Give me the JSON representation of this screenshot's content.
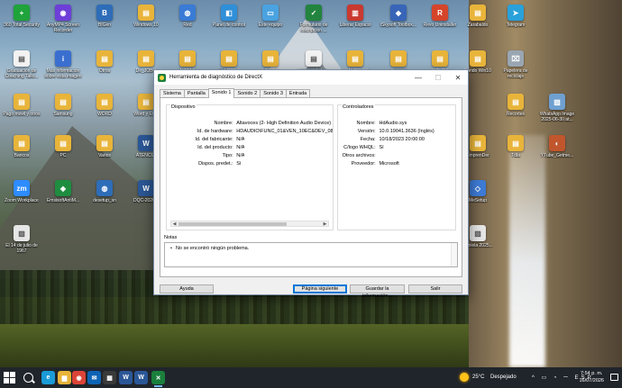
{
  "desktop": {
    "icons": [
      {
        "label": "360 Total Security",
        "glyph": "+",
        "color": "#1fa33b"
      },
      {
        "label": "AnyMP4 Screen Recorder",
        "glyph": "◉",
        "color": "#6e3fd8"
      },
      {
        "label": "BIGen",
        "glyph": "B",
        "color": "#2e6db8"
      },
      {
        "label": "Windows 10",
        "glyph": "▤",
        "color": "#e8b43a"
      },
      {
        "label": "Red",
        "glyph": "◍",
        "color": "#3a7bd5"
      },
      {
        "label": "Panel de control",
        "glyph": "◧",
        "color": "#2f8fd8"
      },
      {
        "label": "Este equipo",
        "glyph": "▭",
        "color": "#4aa3e0"
      },
      {
        "label": "Formulario de inscripción ...",
        "glyph": "✓",
        "color": "#23843f"
      },
      {
        "label": "Liberar Espacio",
        "glyph": "▥",
        "color": "#c9392f"
      },
      {
        "label": "iSkysoft Toolbox...",
        "glyph": "◆",
        "color": "#3865b8"
      },
      {
        "label": "Revo Uninstaller",
        "glyph": "R",
        "color": "#d5452a"
      },
      {
        "label": "Zarabaldo",
        "glyph": "▤",
        "color": "#e8b43a"
      },
      {
        "label": "Telegram",
        "glyph": "➤",
        "color": "#2aa1da"
      },
      {
        "label": "Graduación de Coaching Tallo...",
        "glyph": "▤",
        "color": "#f2f2f2"
      },
      {
        "label": "Más información sobre esta imagen",
        "glyph": "i",
        "color": "#3a6fd0"
      },
      {
        "label": "Otros",
        "glyph": "▤",
        "color": "#e8b43a"
      },
      {
        "label": "De_JOBO",
        "glyph": "▤",
        "color": "#e8b43a"
      },
      {
        "label": "NOTAS",
        "glyph": "▤",
        "color": "#e8b43a"
      },
      {
        "label": "Word OTROS",
        "glyph": "▤",
        "color": "#e8b43a"
      },
      {
        "label": "LIBROS",
        "glyph": "▤",
        "color": "#e8b43a"
      },
      {
        "label": "Registro de Lid...",
        "glyph": "▤",
        "color": "#f2f2f2"
      },
      {
        "label": "FRANCISCO",
        "glyph": "▤",
        "color": "#e8b43a"
      },
      {
        "label": "Sintesis",
        "glyph": "▤",
        "color": "#e8b43a"
      },
      {
        "label": "EYE 110",
        "glyph": "▤",
        "color": "#e8b43a"
      },
      {
        "label": "Fondo Win10",
        "glyph": "▤",
        "color": "#e8b43a"
      },
      {
        "label": "Papelera de reciclaje",
        "glyph": "⌧",
        "color": "#9aa6b2"
      },
      {
        "label": "Pago movil y otros",
        "glyph": "▤",
        "color": "#e8b43a"
      },
      {
        "label": "Samsung",
        "glyph": "▤",
        "color": "#e8b43a"
      },
      {
        "label": "WORD",
        "glyph": "▤",
        "color": "#e8b43a"
      },
      {
        "label": "Word y Ex...",
        "glyph": "▤",
        "color": "#e8b43a"
      },
      {
        "label": "Recortes",
        "glyph": "▤",
        "color": "#e8b43a"
      },
      {
        "label": "WhatsApp Image 2025-06-30 at...",
        "glyph": "▨",
        "color": "#6fa0d0"
      },
      {
        "label": "Bancos",
        "glyph": "▤",
        "color": "#e8b43a"
      },
      {
        "label": "PC",
        "glyph": "▤",
        "color": "#e8b43a"
      },
      {
        "label": "Varios",
        "glyph": "▤",
        "color": "#e8b43a"
      },
      {
        "label": "ATENCI...",
        "glyph": "W",
        "color": "#2b5797"
      },
      {
        "label": "EmprenDer",
        "glyph": "▤",
        "color": "#e8b43a"
      },
      {
        "label": "Tdla",
        "glyph": "▤",
        "color": "#e8b43a"
      },
      {
        "label": "YTube_Getme...",
        "glyph": "◐",
        "color": "#c1562d"
      },
      {
        "label": "Zoom Workplace",
        "glyph": "zm",
        "color": "#2d8cff"
      },
      {
        "label": "EmsisoftAntiM...",
        "glyph": "◈",
        "color": "#1f8d3f"
      },
      {
        "label": "desetup_sn",
        "glyph": "◍",
        "color": "#2e6db8"
      },
      {
        "label": "DQC-2026...",
        "glyph": "W",
        "color": "#2b5797"
      },
      {
        "label": "MeSetup",
        "glyph": "◇",
        "color": "#3d7bd6"
      },
      {
        "label": "El 14 de julio de 1967",
        "glyph": "▨",
        "color": "#e6e6e6"
      },
      {
        "label": "Daniela 2025...",
        "glyph": "▨",
        "color": "#e6e6e6"
      }
    ]
  },
  "window": {
    "title": "Herramienta de diagnóstico de DirectX",
    "controls": {
      "minimize": "—",
      "maximize": "☐",
      "close": "✕"
    },
    "tabs": [
      "Sistema",
      "Pantalla",
      "Sonido 1",
      "Sonido 2",
      "Sonido 3",
      "Entrada"
    ],
    "active_tab_index": 2,
    "device": {
      "title": "Dispositivo",
      "rows": [
        {
          "key": "Nombre:",
          "value": "Altavoces (2- High Definition Audio Device)"
        },
        {
          "key": "Id. de hardware:",
          "value": "HDAUDIO\\FUNC_01&VEN_10EC&DEV_0887&SUBSYS_1043"
        },
        {
          "key": "Id. del fabricante:",
          "value": "N/A"
        },
        {
          "key": "Id. del producto:",
          "value": "N/A"
        },
        {
          "key": "Tipo:",
          "value": "N/A"
        },
        {
          "key": "Dispos. predet.:",
          "value": "Sí"
        }
      ],
      "scroll_arrow_left": "◀",
      "scroll_arrow_right": "▶"
    },
    "drivers": {
      "title": "Controladores",
      "rows": [
        {
          "key": "Nombre:",
          "value": "HdAudio.sys"
        },
        {
          "key": "Versión:",
          "value": "10.0.19041.3636 (Inglés)"
        },
        {
          "key": "Fecha:",
          "value": "10/18/2023 20:00:00"
        },
        {
          "key": "C/logo WHQL:",
          "value": "Sí"
        },
        {
          "key": "Otros archivos:",
          "value": ""
        },
        {
          "key": "Proveedor:",
          "value": "Microsoft"
        }
      ]
    },
    "notes": {
      "label": "Notas",
      "items": [
        "No se encontró ningún problema."
      ]
    },
    "buttons": {
      "help": "Ayuda",
      "next_page": "Página siguiente",
      "save_all": "Guardar la información...",
      "exit": "Salir"
    }
  },
  "taskbar": {
    "apps": [
      {
        "name": "edge",
        "glyph": "e",
        "color": "#1a9bd7"
      },
      {
        "name": "file-explorer",
        "glyph": "▆",
        "color": "#e8b43a"
      },
      {
        "name": "chrome",
        "glyph": "◉",
        "color": "#db4437"
      },
      {
        "name": "mail",
        "glyph": "✉",
        "color": "#0e63b5"
      },
      {
        "name": "store",
        "glyph": "▦",
        "color": "#3a3a3a"
      },
      {
        "name": "word",
        "glyph": "W",
        "color": "#2b5797"
      },
      {
        "name": "word-2",
        "glyph": "W",
        "color": "#2b5797"
      },
      {
        "name": "directx",
        "glyph": "✕",
        "color": "#1a7f3c"
      }
    ],
    "weather": {
      "temp": "25°C",
      "condition": "Despejado"
    },
    "tray_icons": "^ ▭ ◔ 𝄖 ESP",
    "time": "7:54 p. m.",
    "date": "16/07/2026"
  }
}
